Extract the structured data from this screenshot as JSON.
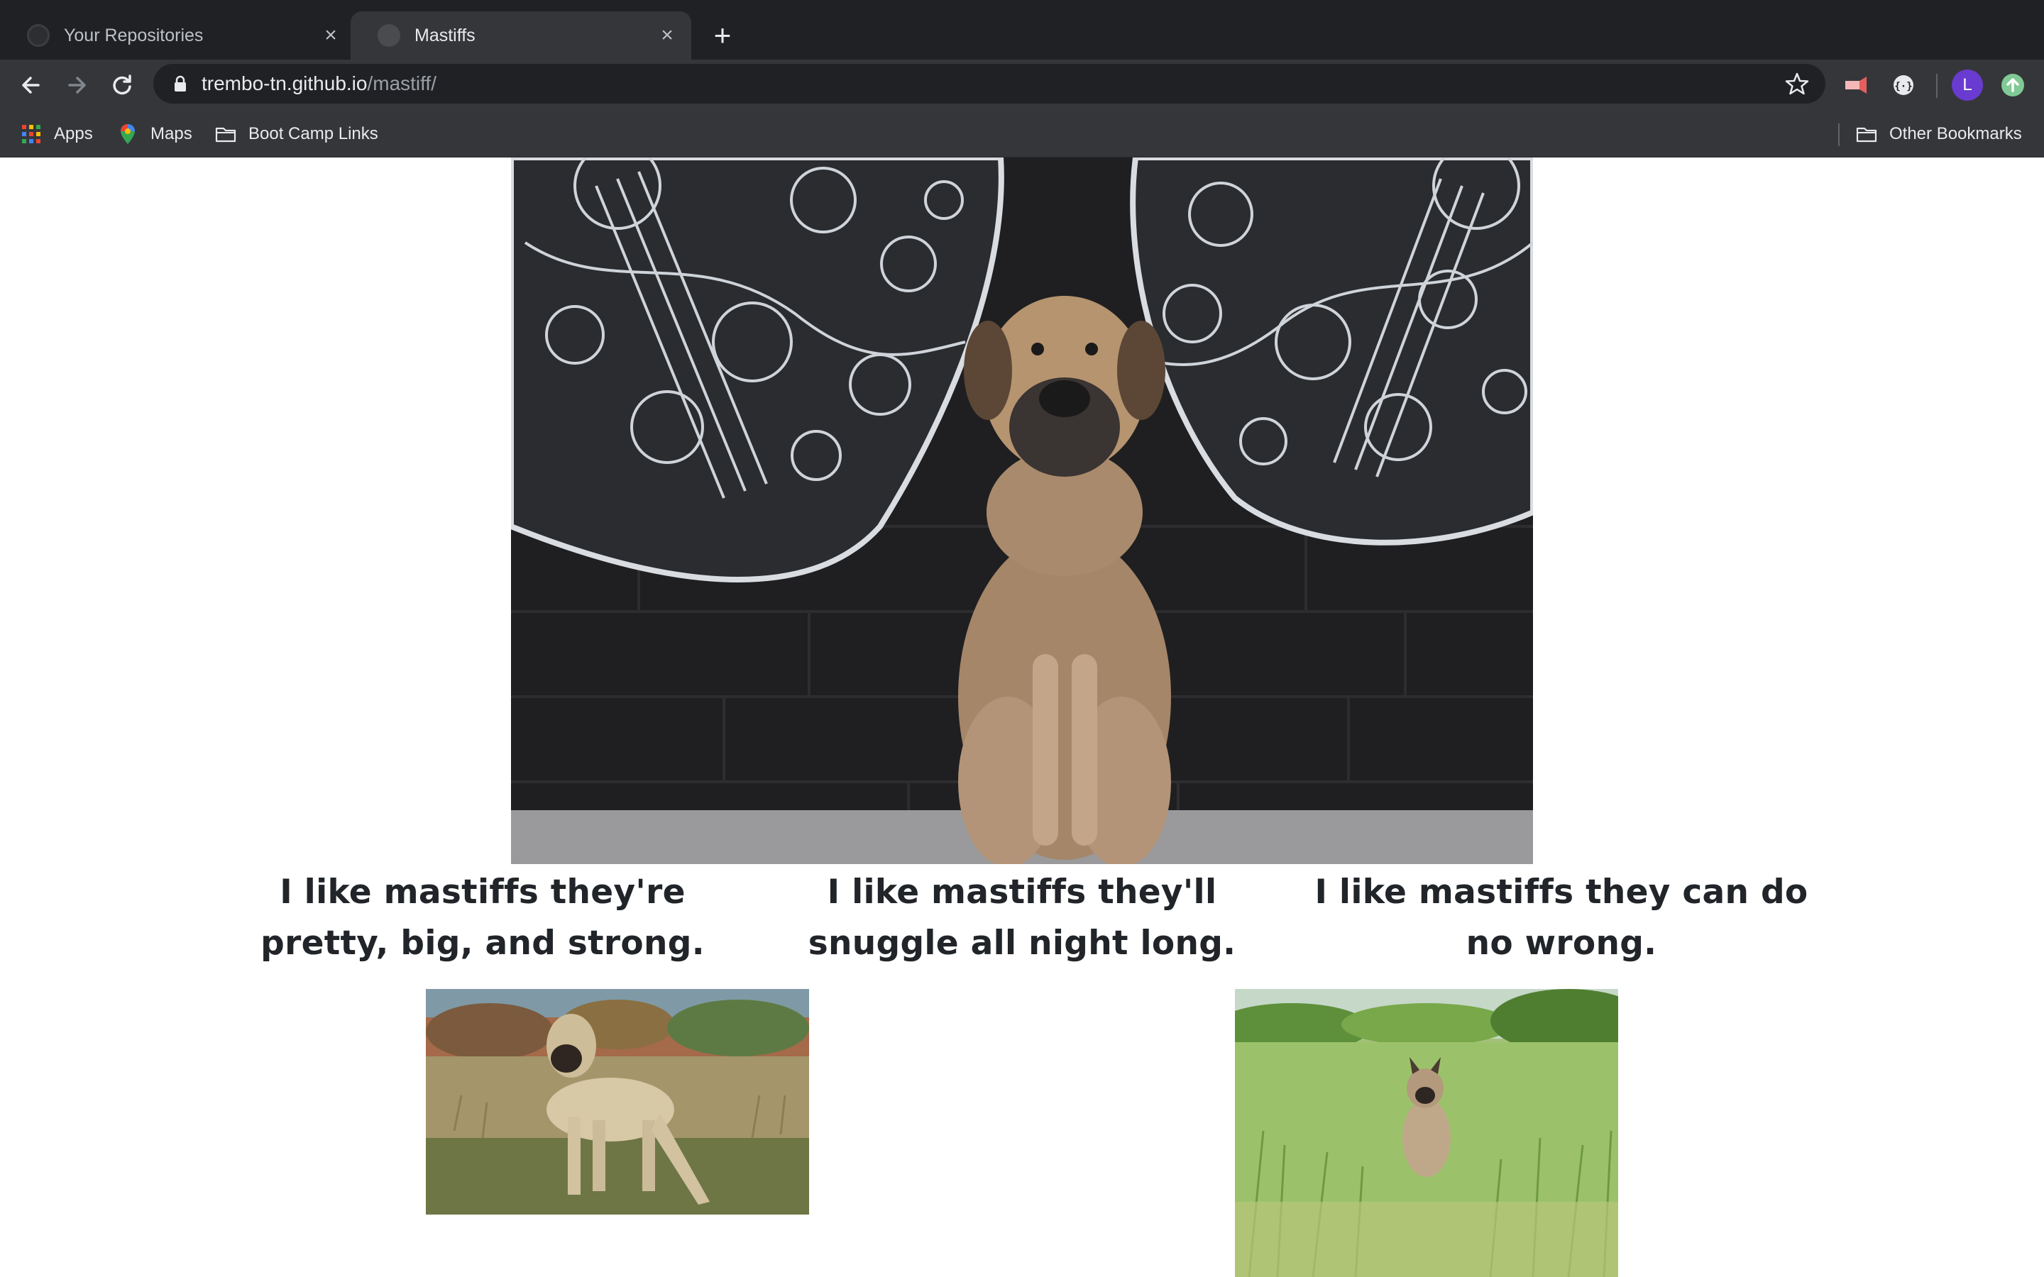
{
  "browser": {
    "tabs": [
      {
        "title": "Your Repositories",
        "active": false,
        "favicon": "github-icon"
      },
      {
        "title": "Mastiffs",
        "active": true,
        "favicon": "globe-icon"
      }
    ],
    "url": {
      "host": "trembo-tn.github.io",
      "path": "/mastiff/"
    },
    "profile_initial": "L",
    "bookmarks": [
      {
        "label": "Apps",
        "icon": "apps-grid-icon"
      },
      {
        "label": "Maps",
        "icon": "maps-pin-icon"
      },
      {
        "label": "Boot Camp Links",
        "icon": "folder-icon"
      }
    ],
    "other_bookmarks": {
      "label": "Other Bookmarks",
      "icon": "folder-icon"
    }
  },
  "page": {
    "hero_image": {
      "description": "mastiff-in-front-of-guitar-mural",
      "icon": "photo"
    },
    "captions": [
      "I like mastiffs they're pretty, big, and strong.",
      "I like mastiffs they'll snuggle all night long.",
      "I like mastiffs they can do no wrong."
    ],
    "gallery": [
      {
        "description": "mastiff-standing-in-field"
      },
      {
        "description": "mastiff-in-tall-grass"
      }
    ]
  },
  "colors": {
    "chrome_dark": "#202124",
    "chrome_toolbar": "#35363a",
    "text_light": "#e8eaed",
    "caption_text": "#212529",
    "avatar": "#6a3bd0"
  }
}
